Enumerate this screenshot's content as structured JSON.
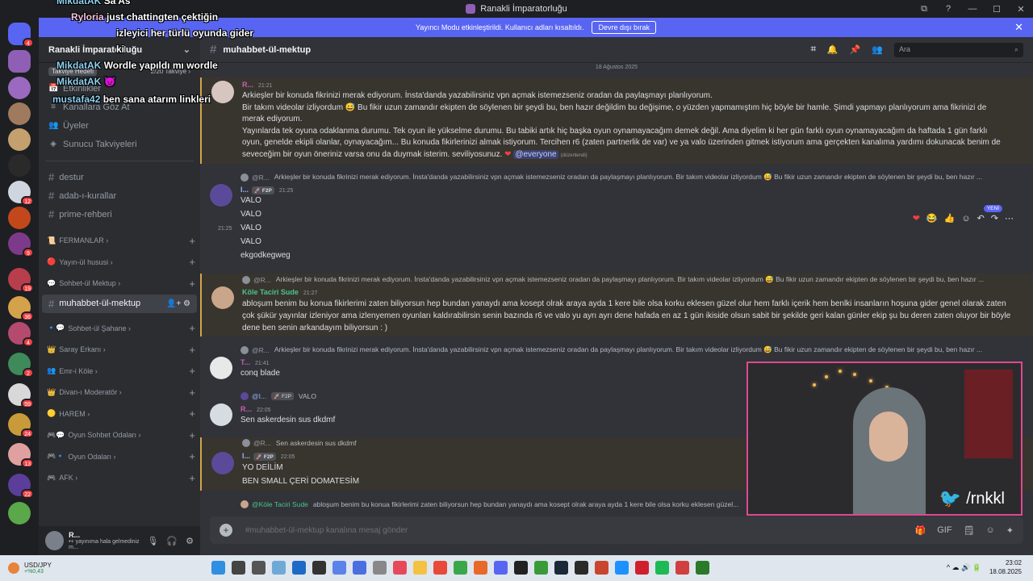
{
  "window": {
    "title": "Ranakli İmparatorluğu",
    "controls": [
      "⧉",
      "?",
      "—",
      "☐",
      "✕"
    ]
  },
  "streamer_bar": {
    "text": "Yayıncı Modu etkinleştirildi. Kullanıcı adları kısaltıldı.",
    "button": "Devre dışı bırak",
    "close": "✕"
  },
  "guilds": {
    "badges": [
      "4",
      "12",
      "9",
      "19",
      "36",
      "4",
      "2",
      "59",
      "24",
      "13",
      "22"
    ]
  },
  "sidebar": {
    "server_name": "Ranakli İmparatorluğu",
    "chevron": "⌄",
    "boost_tag": "Takviye Hedefi",
    "boost_count": "2/20 Takviye ›",
    "nav": [
      {
        "label": "Etkinlikler",
        "icon": "📅"
      },
      {
        "label": "Kanallara Göz At",
        "icon": "≡"
      },
      {
        "label": "Üyeler",
        "icon": "👥"
      },
      {
        "label": "Sunucu Takviyeleri",
        "icon": "◈"
      }
    ],
    "channels": [
      {
        "label": "destur"
      },
      {
        "label": "adab-ı-kurallar"
      },
      {
        "label": "prime-rehberi"
      }
    ],
    "categories_a": [
      {
        "label": "FERMANLAR ›",
        "emoji": "📜"
      },
      {
        "label": "Yayın-ül hususi ›",
        "emoji": "🔴"
      },
      {
        "label": "Sohbet-ül Mektup ›",
        "emoji": "💬"
      }
    ],
    "active_channel": {
      "label": "muhabbet-ül-mektup",
      "icons": "👤+ ⚙"
    },
    "categories_b": [
      {
        "label": "Sohbet-ül Şahane ›",
        "emoji": "🔹💬"
      },
      {
        "label": "Saray Erkanı ›",
        "emoji": "👑"
      },
      {
        "label": "Emr-i Köle ›",
        "emoji": "👥"
      },
      {
        "label": "Divan-ı Moderatör ›",
        "emoji": "👑"
      },
      {
        "label": "HAREM ›",
        "emoji": "🟡"
      },
      {
        "label": "Oyun Sohbet Odaları ›",
        "emoji": "🎮💬"
      },
      {
        "label": "Oyun Odaları ›",
        "emoji": "🎮🔹"
      },
      {
        "label": "AFK ›",
        "emoji": "🎮"
      }
    ],
    "user": {
      "name": "R...",
      "status": "•+ yayınıma hala gelmediniz m..."
    }
  },
  "channel_header": {
    "name": "muhabbet-ül-mektup",
    "icons": [
      "threads-icon",
      "bell-icon",
      "pin-icon",
      "members-icon"
    ],
    "search_placeholder": "Ara"
  },
  "date_divider": "18 Ağustos 2025",
  "messages": {
    "m1": {
      "author": "R...",
      "time": "21:21",
      "lines": [
        "Arkieşler bir konuda fikrinizi merak ediyorum. İnsta'danda yazabilirsiniz vpn açmak istemezseniz oradan da paylaşmayı planlıyorum.",
        "Bir takım videolar izliyordum 😅 Bu fikir uzun zamandır ekipten de söylenen bir şeydi bu, ben hazır değildim bu değişime, o yüzden yapmamıştım hiç böyle bir hamle. Şimdi yapmayı planlıyorum ama fikrinizi de",
        "merak ediyorum.",
        "Yayınlarda tek oyuna odaklanma durumu. Tek oyun ile yükselme durumu. Bu tabiki artık hiç başka oyun oynamayacağım demek değil. Ama diyelim ki her gün farklı oyun oynamayacağım da haftada 1 gün farklı",
        "oyun, genelde ekipli olanlar, oynayacağım... Bu konuda fikirlerinizi almak istiyorum. Tercihen r6 (zaten partnerlik de var) ve ya valo üzerinden gitmek istiyorum ama gerçekten kanalıma yardımı dokunacak benim de",
        "seveceğim bir oyun öneriniz varsa onu da duymak isterim. seviliyosunuz."
      ],
      "heart": "❤",
      "mention": "@everyone",
      "edited": "(düzenlendi)"
    },
    "reply_text": "Arkieşler bir konuda fikrinizi merak ediyorum. İnsta'danda yazabilirsiniz vpn açmak istemezseniz oradan da paylaşmayı planlıyorum.  Bir takım videolar izliyordum 😅 Bu fikir uzun zamandır ekipten de söylenen bir şeydi bu, ben hazır ...",
    "reply_name": "@R...",
    "m2": {
      "author": "I...",
      "tag": "🚀 F2P",
      "time": "21:25",
      "lines": [
        "VALO",
        "VALO",
        "VALO",
        "VALO",
        "ekgodkegweg"
      ],
      "hover_time": "21:25"
    },
    "m3": {
      "author": "Köle Taciri Sude",
      "time": "21:27",
      "lines": [
        "ablo​şum benim bu konua fikirlerimi zaten biliyorsun hep bundan yanaydı ama kosept olrak araya ayda 1 kere bile olsa korku eklesen güzel olur hem farklı içerik hem benlki insanların hoşuna gider genel olarak zaten",
        "çok şükür yayınlar izleniyor ama izlenyemen oyunları kaldırabilirsin senin bazında r6 ve valo yu ayrı ayrı dene hafada en az 1 gün ikiside olsun sabit bir şekilde geri kalan günler ekip şu bu deren zaten oluyor bir böyle",
        "dene ben senin arkandayım biliyorsun : )"
      ]
    },
    "m4": {
      "author": "T...",
      "time": "21:41",
      "lines": [
        "conq blade"
      ]
    },
    "m5": {
      "reply_name": "@I...",
      "reply_tag": "🚀 F2P",
      "reply_text": "VALO",
      "author": "R...",
      "time": "22:05",
      "lines": [
        "Sen askerdesin sus dkdmf"
      ]
    },
    "m6": {
      "reply_name": "@R...",
      "reply_text": "Sen askerdesin sus dkdmf",
      "author": "I...",
      "tag": "🚀 F2P",
      "time": "22:05",
      "lines": [
        "YO DEİLİM",
        "BEN SMALL ÇERİ DOMATESİM"
      ]
    },
    "m7": {
      "reply_name": "@Köle Taciri Sude",
      "reply_text": "ablo​şum benim bu konua fikirlerimi zaten biliyorsun hep bundan yanaydı ama kosept olrak araya ayda 1 kere bile olsa korku eklesen güzel..."
    }
  },
  "reactions": {
    "new": "YENİ",
    "items": [
      "❤",
      "😂",
      "👍",
      "☺",
      "↶",
      "↷",
      "⋯"
    ]
  },
  "composer": {
    "plus": "+",
    "placeholder": "#muhabbet-ül-mektup kanalına mesaj gönder",
    "icons": [
      "🎁",
      "GIF",
      "🗒",
      "☺",
      "✦"
    ]
  },
  "webcam": {
    "handle": "/rnkkl",
    "bird": "🐦"
  },
  "stream_chat": [
    {
      "name": "MikdatAK",
      "text": "Sa As"
    },
    {
      "name": "Ryloria",
      "text": "just chattingten çektiğin"
    },
    {
      "name": "",
      "text": "izleyici her türlü oyunda gider"
    },
    {
      "name": "",
      "text": "ki"
    },
    {
      "name": "MikdatAK",
      "text": "Wordle yapıldı mı wordle"
    },
    {
      "name": "MikdatAK",
      "text": "😈"
    },
    {
      "name": "mustafa42",
      "text": "ben sana atarım linkleri"
    }
  ],
  "taskbar": {
    "widget_title": "USD/JPY",
    "widget_change": "+%0,43",
    "widget_badge": "6",
    "tray": "^  ☁  🔊  🔋",
    "time": "23:02",
    "date": "18.08.2025"
  },
  "colors": {
    "accent": "#5865f2",
    "highlight_border": "#d2a64b",
    "cam_border": "#e04890",
    "twitter": "#1da1f2"
  }
}
